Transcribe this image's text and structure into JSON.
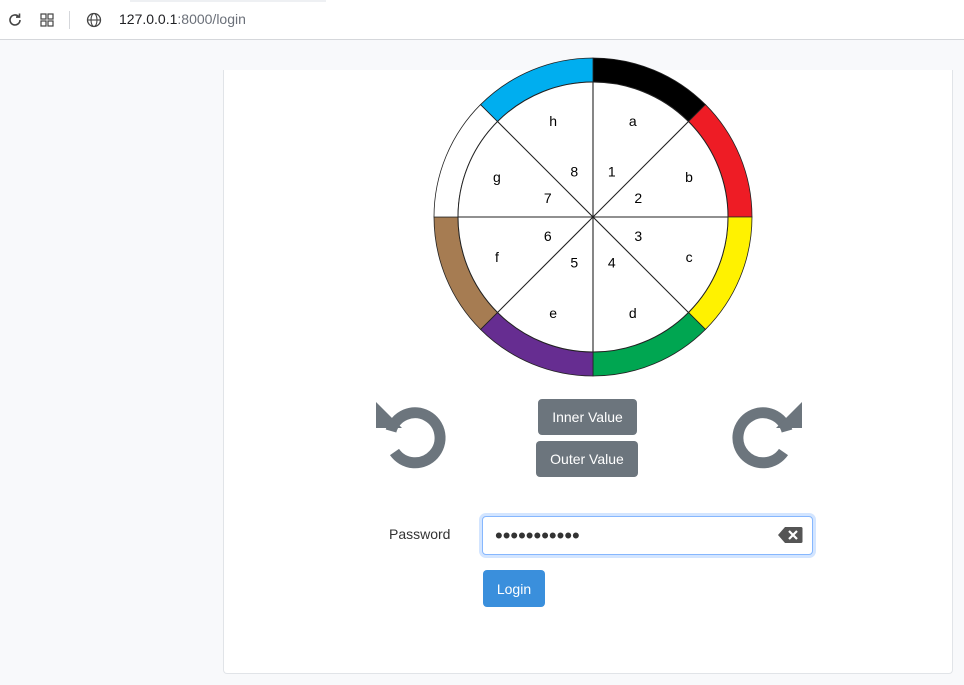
{
  "browser": {
    "url_host": "127.0.0.1",
    "url_path": ":8000/login"
  },
  "wheel": {
    "outer_ring_colors": [
      "#000000",
      "#ee1c25",
      "#fff200",
      "#00a651",
      "#662d91",
      "#a67c52",
      "#ffffff",
      "#00aeef"
    ],
    "outer_letters": [
      "a",
      "b",
      "c",
      "d",
      "e",
      "f",
      "g",
      "h"
    ],
    "inner_numbers": [
      "1",
      "2",
      "3",
      "4",
      "5",
      "6",
      "7",
      "8"
    ]
  },
  "controls": {
    "inner_value_label": "Inner Value",
    "outer_value_label": "Outer Value"
  },
  "form": {
    "password_label": "Password",
    "password_value": "•••••••••••",
    "login_label": "Login"
  },
  "icons": {
    "rotate_left": "rotate-counterclockwise-icon",
    "rotate_right": "rotate-clockwise-icon",
    "clear": "backspace-clear-icon"
  }
}
